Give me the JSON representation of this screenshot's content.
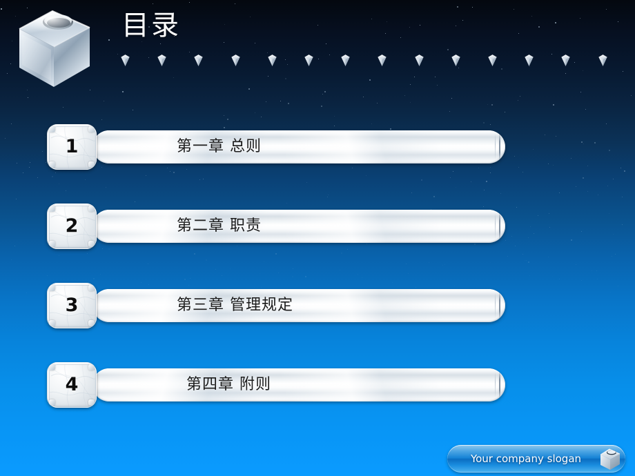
{
  "slide": {
    "title": "目录",
    "logo_icon": "metallic-cube-logo",
    "background": {
      "top_color": "#04080f",
      "mid_color": "#0a538f",
      "bottom_color": "#0a9bff"
    },
    "divider_gem_icon": "small-metallic-gem",
    "divider_gem_count": 14
  },
  "toc": {
    "items": [
      {
        "number": "1",
        "label": "第一章  总则",
        "indented": false
      },
      {
        "number": "2",
        "label": "第二章  职责",
        "indented": false
      },
      {
        "number": "3",
        "label": "第三章  管理规定",
        "indented": false
      },
      {
        "number": "4",
        "label": "第四章  附则",
        "indented": true
      }
    ]
  },
  "footer": {
    "slogan": "Your company slogan",
    "icon": "metallic-cube-icon",
    "accent_color": "#1683d6"
  }
}
